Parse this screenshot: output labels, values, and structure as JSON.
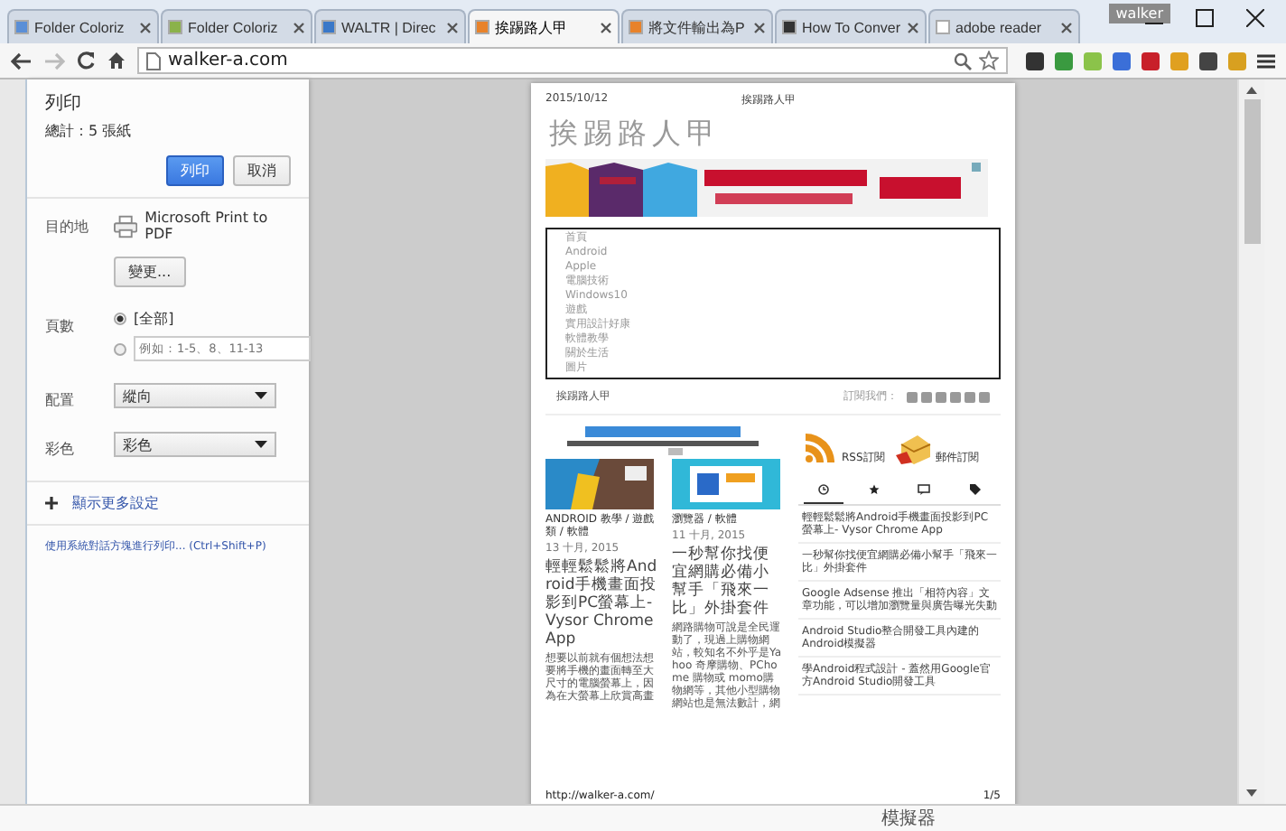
{
  "browser": {
    "tabs": [
      {
        "title": "Folder Coloriz",
        "selected": false
      },
      {
        "title": "Folder Coloriz",
        "selected": false
      },
      {
        "title": "WALTR | Direc",
        "selected": false
      },
      {
        "title": "挨踢路人甲",
        "selected": true
      },
      {
        "title": "將文件輸出為P",
        "selected": false
      },
      {
        "title": "How To Conver",
        "selected": false
      },
      {
        "title": "adobe reader",
        "selected": false
      }
    ],
    "profile": "walker",
    "address": "walker-a.com"
  },
  "print_panel": {
    "title": "列印",
    "total": "總計：5 張紙",
    "buttons": [
      {
        "label": "列印",
        "kind": "primary"
      },
      {
        "label": "取消",
        "kind": "secondary"
      }
    ],
    "settings": [
      {
        "kind": "destination",
        "label": "目的地",
        "printer": "Microsoft Print to PDF",
        "button": "變更..."
      },
      {
        "kind": "pages",
        "label": "頁數",
        "options": [
          {
            "label": "[全部]",
            "selected": true
          },
          {
            "placeholder": "例如：1-5、8、11-13",
            "selected": false
          }
        ]
      },
      {
        "kind": "select",
        "label": "配置",
        "value": "縱向"
      },
      {
        "kind": "select",
        "label": "彩色",
        "value": "彩色"
      }
    ],
    "more_settings": "顯示更多設定",
    "system_dialog_link": "使用系統對話方塊進行列印... (Ctrl+Shift+P)"
  },
  "preview": {
    "header": {
      "date": "2015/10/12",
      "title": "挨踢路人甲"
    },
    "site_title": "挨踢路人甲",
    "nav": [
      "首頁",
      "Android",
      "Apple",
      "電腦技術",
      "Windows10",
      "遊戲",
      "實用設計好康",
      "軟體教學",
      "關於生活",
      "圖片"
    ],
    "section_title": "挨踢路人甲",
    "subscribe": "訂閱我們：",
    "posts": [
      {
        "category": "ANDROID 教學 / 遊戲類 / 軟體",
        "date": "13 十月, 2015",
        "title": "輕輕鬆鬆將Android手機畫面投影到PC螢幕上- Vysor Chrome App",
        "excerpt": "想要以前就有個想法想要將手機的畫面轉至大尺寸的電腦螢幕上，因為在大螢幕上欣賞高畫"
      },
      {
        "category": "瀏覽器 / 軟體",
        "date": "11 十月, 2015",
        "title": "一秒幫你找便宜網購必備小幫手「飛來一比」外掛套件",
        "excerpt": "網路購物可說是全民運動了，現過上購物網站，較知名不外乎是Yahoo 奇摩購物、PChome 購物或 momo購物網等，其他小型購物網站也是無法數計，網"
      }
    ],
    "feeds": [
      "RSS訂閱",
      "郵件訂閱"
    ],
    "sidebar_tabs": [
      {
        "selected": true
      },
      {
        "selected": false
      },
      {
        "selected": false
      },
      {
        "selected": false
      }
    ],
    "recent": [
      "輕輕鬆鬆將Android手機畫面投影到PC螢幕上- Vysor Chrome App",
      "一秒幫你找便宜網購必備小幫手「飛來一比」外掛套件",
      "Google Adsense 推出「相符內容」文章功能，可以增加瀏覽量與廣告曝光失動",
      "Android Studio整合開發工具內建的Android模擬器",
      "學Android程式設計 - 蓋然用Google官方Android Studio開發工具"
    ],
    "footer": {
      "url": "http://walker-a.com/",
      "page": "1/5"
    }
  },
  "background_page": {
    "text": "模擬器"
  }
}
